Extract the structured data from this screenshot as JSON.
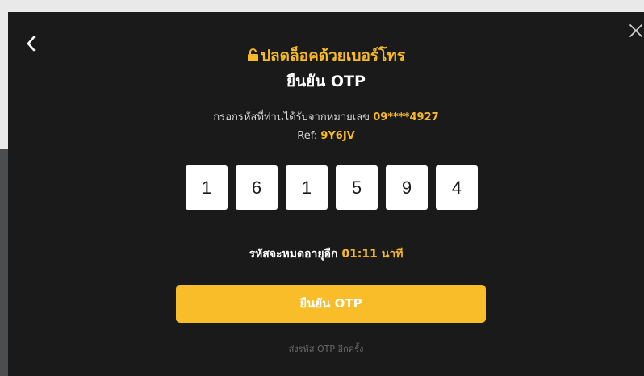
{
  "header": {
    "lock_icon": "lock-icon",
    "title": "ปลดล็อคด้วยเบอร์โทร",
    "subtitle": "ยืนยัน OTP",
    "back_icon": "chevron-left-icon",
    "close_icon": "close-icon"
  },
  "instruction": {
    "text": "กรอกรหัสที่ท่านได้รับจากหมายเลข",
    "phone": "09****4927",
    "ref_label": "Ref:",
    "ref_code": "9Y6JV"
  },
  "otp": {
    "digits": [
      "1",
      "6",
      "1",
      "5",
      "9",
      "4"
    ]
  },
  "expiry": {
    "label": "รหัสจะหมดอายุอีก",
    "time": "01:11",
    "unit": "นาที"
  },
  "actions": {
    "confirm_label": "ยืนยัน OTP",
    "resend_label": "ส่งรหัส OTP อีกครั้ง"
  },
  "colors": {
    "accent": "#f7b924",
    "button": "#f8bd29",
    "modal_bg": "#1a1a1a"
  }
}
